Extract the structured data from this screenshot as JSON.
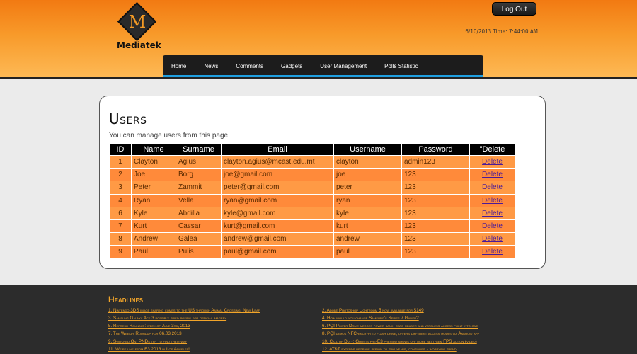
{
  "header": {
    "logo_letter": "M",
    "logo_text": "Mediatek",
    "logout_label": "Log Out",
    "datetime": "6/10/2013 Time: 7:44:00 AM"
  },
  "nav": {
    "items": [
      "Home",
      "News",
      "Comments",
      "Gadgets",
      "User Management",
      "Polls Statistic"
    ]
  },
  "main": {
    "title": "Users",
    "subtitle": "You can manage users from this page",
    "columns": [
      "ID",
      "Name",
      "Surname",
      "Email",
      "Username",
      "Password",
      "\"Delete"
    ],
    "rows": [
      {
        "id": "1",
        "name": "Clayton",
        "surname": "Agius",
        "email": "clayton.agius@mcast.edu.mt",
        "username": "clayton",
        "password": "admin123",
        "delete": "Delete"
      },
      {
        "id": "2",
        "name": "Joe",
        "surname": "Borg",
        "email": "joe@gmail.com",
        "username": "joe",
        "password": "123",
        "delete": "Delete"
      },
      {
        "id": "3",
        "name": "Peter",
        "surname": "Zammit",
        "email": "peter@gmail.com",
        "username": "peter",
        "password": "123",
        "delete": "Delete"
      },
      {
        "id": "4",
        "name": "Ryan",
        "surname": "Vella",
        "email": "ryan@gmail.com",
        "username": "ryan",
        "password": "123",
        "delete": "Delete"
      },
      {
        "id": "6",
        "name": "Kyle",
        "surname": "Abdilla",
        "email": "kyle@gmail.com",
        "username": "kyle",
        "password": "123",
        "delete": "Delete"
      },
      {
        "id": "7",
        "name": "Kurt",
        "surname": "Cassar",
        "email": "kurt@gmail.com",
        "username": "kurt",
        "password": "123",
        "delete": "Delete"
      },
      {
        "id": "8",
        "name": "Andrew",
        "surname": "Galea",
        "email": "andrew@gmail.com",
        "username": "andrew",
        "password": "123",
        "delete": "Delete"
      },
      {
        "id": "9",
        "name": "Paul",
        "surname": "Pulis",
        "email": "paul@gmail.com",
        "username": "paul",
        "password": "123",
        "delete": "Delete"
      }
    ]
  },
  "footer": {
    "title": "Headlines",
    "left": [
      "1. Nintendo 3DS image sharing comes to the US through Animal Crossing: New Leaf",
      "3. Samsung Galaxy Ace 3 possibly spied posing for official imagery",
      "5. Refresh Roundup: week of June 3rd, 2013",
      "7. The Weekly Roundup for 06.03.2013",
      "9. Switched On: PNDs try to find their way",
      "11. We're live from E3 2013 in Los Angeles!"
    ],
    "right": [
      "2. Adobe Photoshop Lightroom 5 now available for $149",
      "4. How would you change Samsung's Series 7 Gamer?",
      "6. PQI Power Drive merges power bank, card reader and wireless access point into one",
      "8. PQI demos NFC-encrypted flash drive, offers different access modes via Android app",
      "10. Call of Duty: Ghosts pre-E3 preview shows off more next-gen FPS action (video)",
      "12. AT&T extends upgrade period to two years, continues a worrying trend"
    ]
  }
}
